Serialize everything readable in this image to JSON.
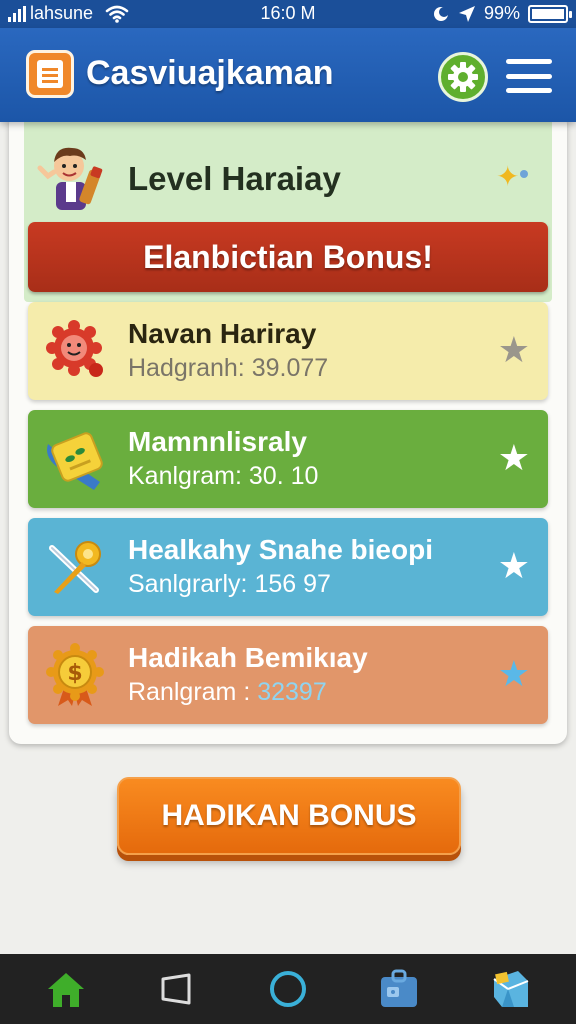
{
  "status_bar": {
    "carrier": "lahsune",
    "time": "16:0 M",
    "battery": "99%",
    "battery_level": 0.99
  },
  "app_bar": {
    "title": "Casviuajkaman"
  },
  "level": {
    "title": "Level Haraiay"
  },
  "banner": {
    "text": "Elanbictian Bonus!"
  },
  "items": [
    {
      "title": "Navan Hariray",
      "subtitle_label": "Hadgranh: ",
      "subtitle_value": "39.077",
      "icon": "red-gear-icon"
    },
    {
      "title": "Mamnnlisraly",
      "subtitle_label": "Kanlgram: ",
      "subtitle_value": "30. 10",
      "icon": "ticket-icon"
    },
    {
      "title": "Healkahy Snahe bieopi",
      "subtitle_label": "Sanlgrarly: ",
      "subtitle_value": "156 97",
      "icon": "pin-icon"
    },
    {
      "title": "Hadikah Bemikıay",
      "subtitle_label": "Ranlgram : ",
      "subtitle_value": "32397",
      "icon": "dollar-medal-icon"
    }
  ],
  "cta": {
    "label": "HADIKAN BONUS"
  },
  "colors": {
    "app_bar": "#1c56a8",
    "banner": "#c83a22",
    "cta": "#f47a15",
    "item_yellow": "#f5ecab",
    "item_green": "#6aae3e",
    "item_blue": "#5ab4d4",
    "item_orange": "#e1966a"
  }
}
